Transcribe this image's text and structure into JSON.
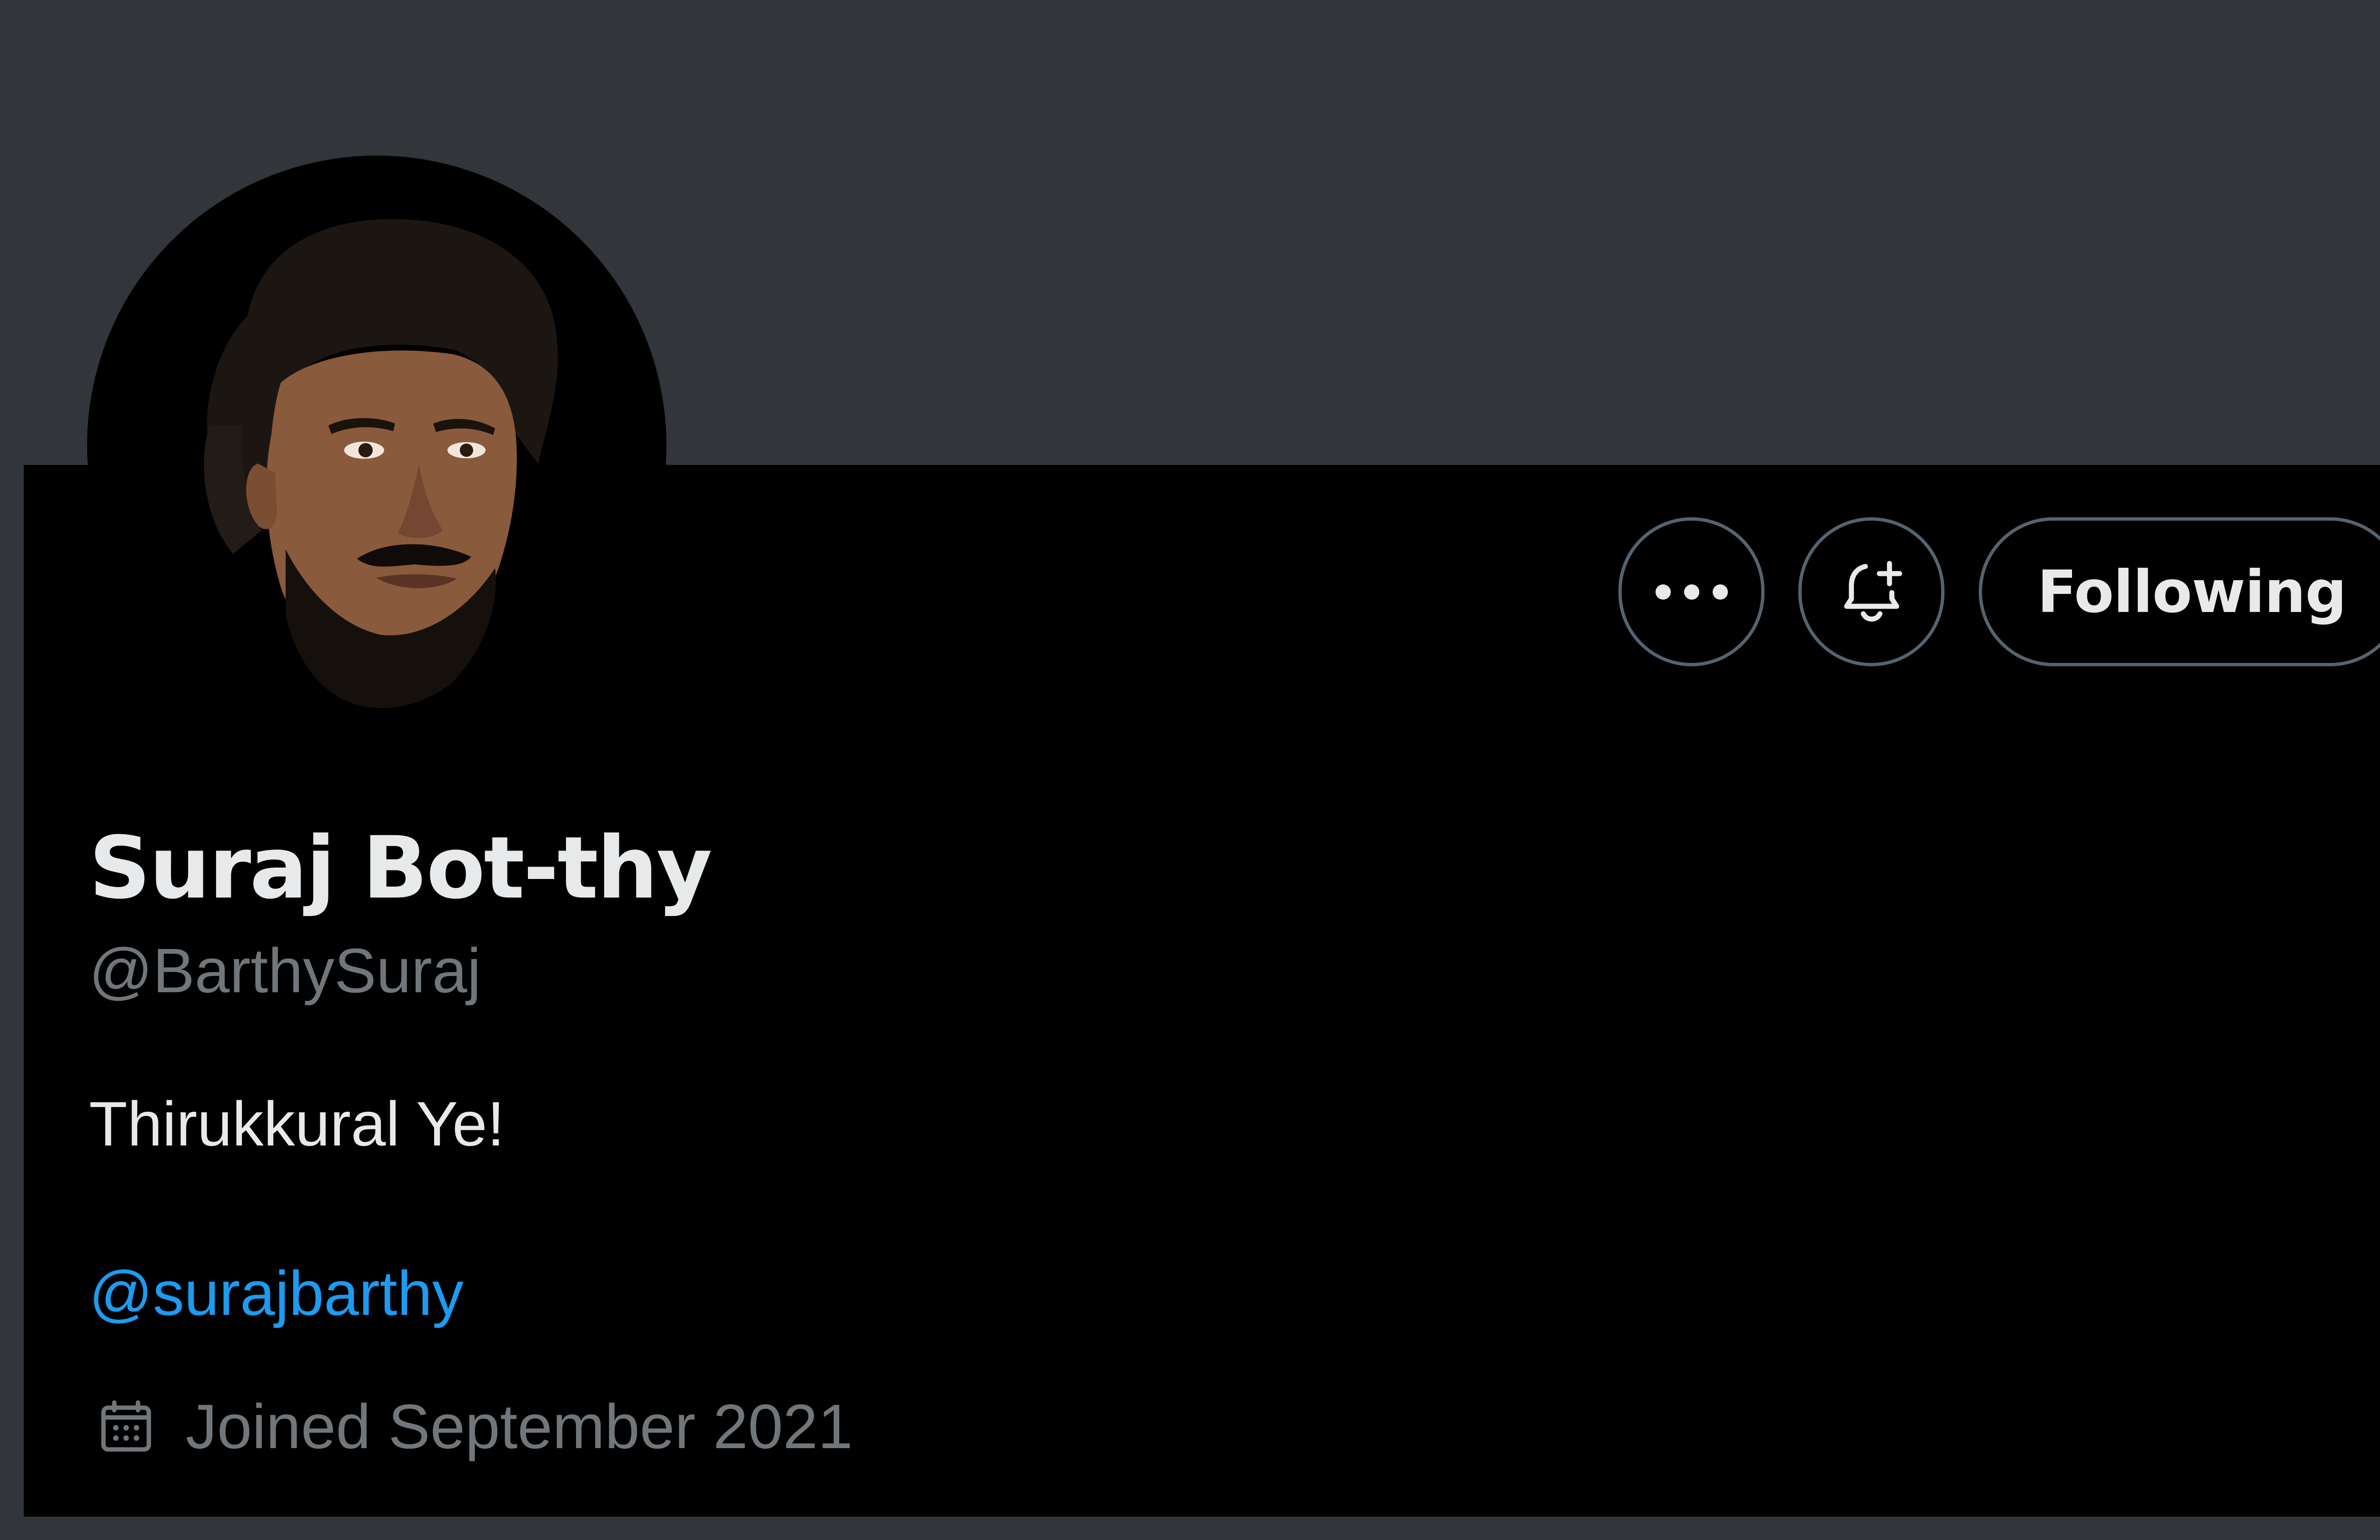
{
  "profile": {
    "display_name": "Suraj Bot-thy",
    "handle": "@BarthySuraj",
    "bio": "Thirukkural Ye!",
    "bio_link": "@surajbarthy",
    "joined": "Joined September 2021"
  },
  "actions": {
    "more_icon": "more-horizontal-icon",
    "notify_icon": "bell-plus-icon",
    "following_label": "Following"
  },
  "colors": {
    "banner": "#323539",
    "card_background": "#000000",
    "primary_text": "#e7e9ea",
    "secondary_text": "#71767b",
    "link": "#1d9bf0",
    "button_border": "#536471"
  },
  "icons": {
    "calendar": "calendar-icon",
    "avatar": "avatar-photo"
  }
}
